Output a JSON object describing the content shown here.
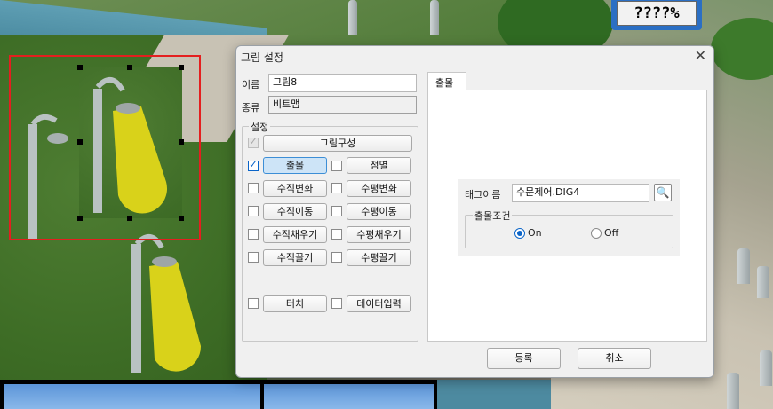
{
  "counter": {
    "text": "????%"
  },
  "dialog": {
    "title": "그림 설정",
    "name_label": "이름",
    "name_value": "그림8",
    "type_label": "종류",
    "type_value": "비트맵",
    "settings_label": "설정",
    "settings": {
      "image_config": {
        "label": "그림구성",
        "checked": true,
        "enabled": false
      },
      "appear": {
        "label": "출몰",
        "checked": true
      },
      "blink": {
        "label": "점멸",
        "checked": false
      },
      "vertical_change": {
        "label": "수직변화",
        "checked": false
      },
      "horizontal_change": {
        "label": "수평변화",
        "checked": false
      },
      "vertical_move": {
        "label": "수직이동",
        "checked": false
      },
      "horizontal_move": {
        "label": "수평이동",
        "checked": false
      },
      "vertical_fill": {
        "label": "수직채우기",
        "checked": false
      },
      "horizontal_fill": {
        "label": "수평채우기",
        "checked": false
      },
      "vertical_drag": {
        "label": "수직끌기",
        "checked": false
      },
      "horizontal_drag": {
        "label": "수평끌기",
        "checked": false
      },
      "touch": {
        "label": "터치",
        "checked": false
      },
      "data_input": {
        "label": "데이터입력",
        "checked": false
      }
    },
    "tab_label": "출몰",
    "tag_label": "태그이름",
    "tag_value": "수문제어.DIG4",
    "condition_label": "출몰조건",
    "on_label": "On",
    "off_label": "Off",
    "condition_value": "On",
    "register_label": "등록",
    "cancel_label": "취소"
  },
  "colors": {
    "selection": "#e41f1f",
    "accent": "#0a64c8",
    "lamp_light": "#d9d21a"
  }
}
